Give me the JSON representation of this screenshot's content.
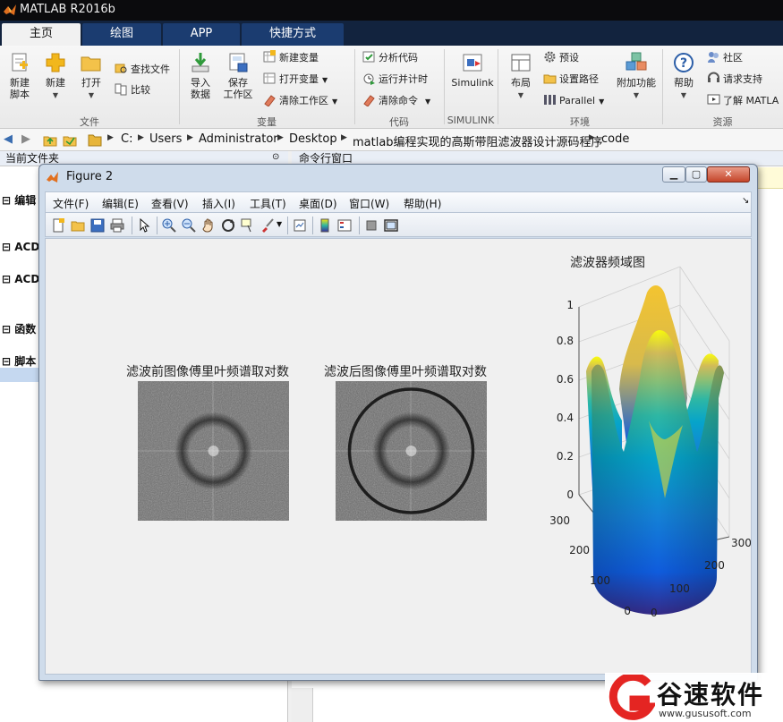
{
  "app": {
    "title": "MATLAB R2016b"
  },
  "main_tabs": [
    {
      "label": "主页",
      "active": true
    },
    {
      "label": "绘图"
    },
    {
      "label": "APP"
    },
    {
      "label": "快捷方式"
    }
  ],
  "ribbon": {
    "file": {
      "group_label": "文件",
      "new_script": "新建\n脚本",
      "new": "新建",
      "open": "打开",
      "find_files": "查找文件",
      "compare": "比较"
    },
    "variable": {
      "group_label": "变量",
      "import_data": "导入\n数据",
      "save_workspace": "保存\n工作区",
      "new_variable": "新建变量",
      "open_variable": "打开变量",
      "clear_workspace": "清除工作区"
    },
    "code": {
      "group_label": "代码",
      "analyze_code": "分析代码",
      "run_and_time": "运行并计时",
      "clear_commands": "清除命令"
    },
    "simulink": {
      "group_label": "SIMULINK",
      "simulink": "Simulink"
    },
    "environment": {
      "group_label": "环境",
      "layout": "布局",
      "preferences": "预设",
      "set_path": "设置路径",
      "parallel": "Parallel",
      "addons": "附加功能"
    },
    "resources": {
      "group_label": "资源",
      "help": "帮助",
      "community": "社区",
      "request_support": "请求支持",
      "learn_matlab": "了解 MATLA"
    }
  },
  "address": {
    "path": [
      "C:",
      "Users",
      "Administrator",
      "Desktop",
      "matlab编程实现的高斯带阻滤波器设计源码程序",
      "code"
    ]
  },
  "left_panel": {
    "header": "当前文件夹",
    "sections": [
      "编辑",
      "ACD",
      "ACD",
      "函数",
      "脚本"
    ]
  },
  "right_panel": {
    "header": "命令行窗口"
  },
  "figure": {
    "title": "Figure 2",
    "menus": [
      "文件(F)",
      "编辑(E)",
      "查看(V)",
      "插入(I)",
      "工具(T)",
      "桌面(D)",
      "窗口(W)",
      "帮助(H)"
    ],
    "plot1_title": "滤波前图像傅里叶频谱取对数",
    "plot2_title": "滤波后图像傅里叶频谱取对数",
    "plot3_title": "滤波器频域图",
    "z_ticks": [
      "0",
      "0.2",
      "0.4",
      "0.6",
      "0.8",
      "1"
    ],
    "x_ticks": [
      "0",
      "100",
      "200",
      "300"
    ],
    "y_ticks": [
      "0",
      "100",
      "200",
      "300"
    ]
  },
  "watermark": {
    "name": "谷速软件",
    "url": "www.gususoft.com"
  },
  "colors": {
    "titlebar": "#0b0b0d",
    "tab_bg": "#1b3c70",
    "ribbon": "#f0f0f0",
    "figure_canvas": "#f0f0f0",
    "logo_red": "#e42522"
  }
}
